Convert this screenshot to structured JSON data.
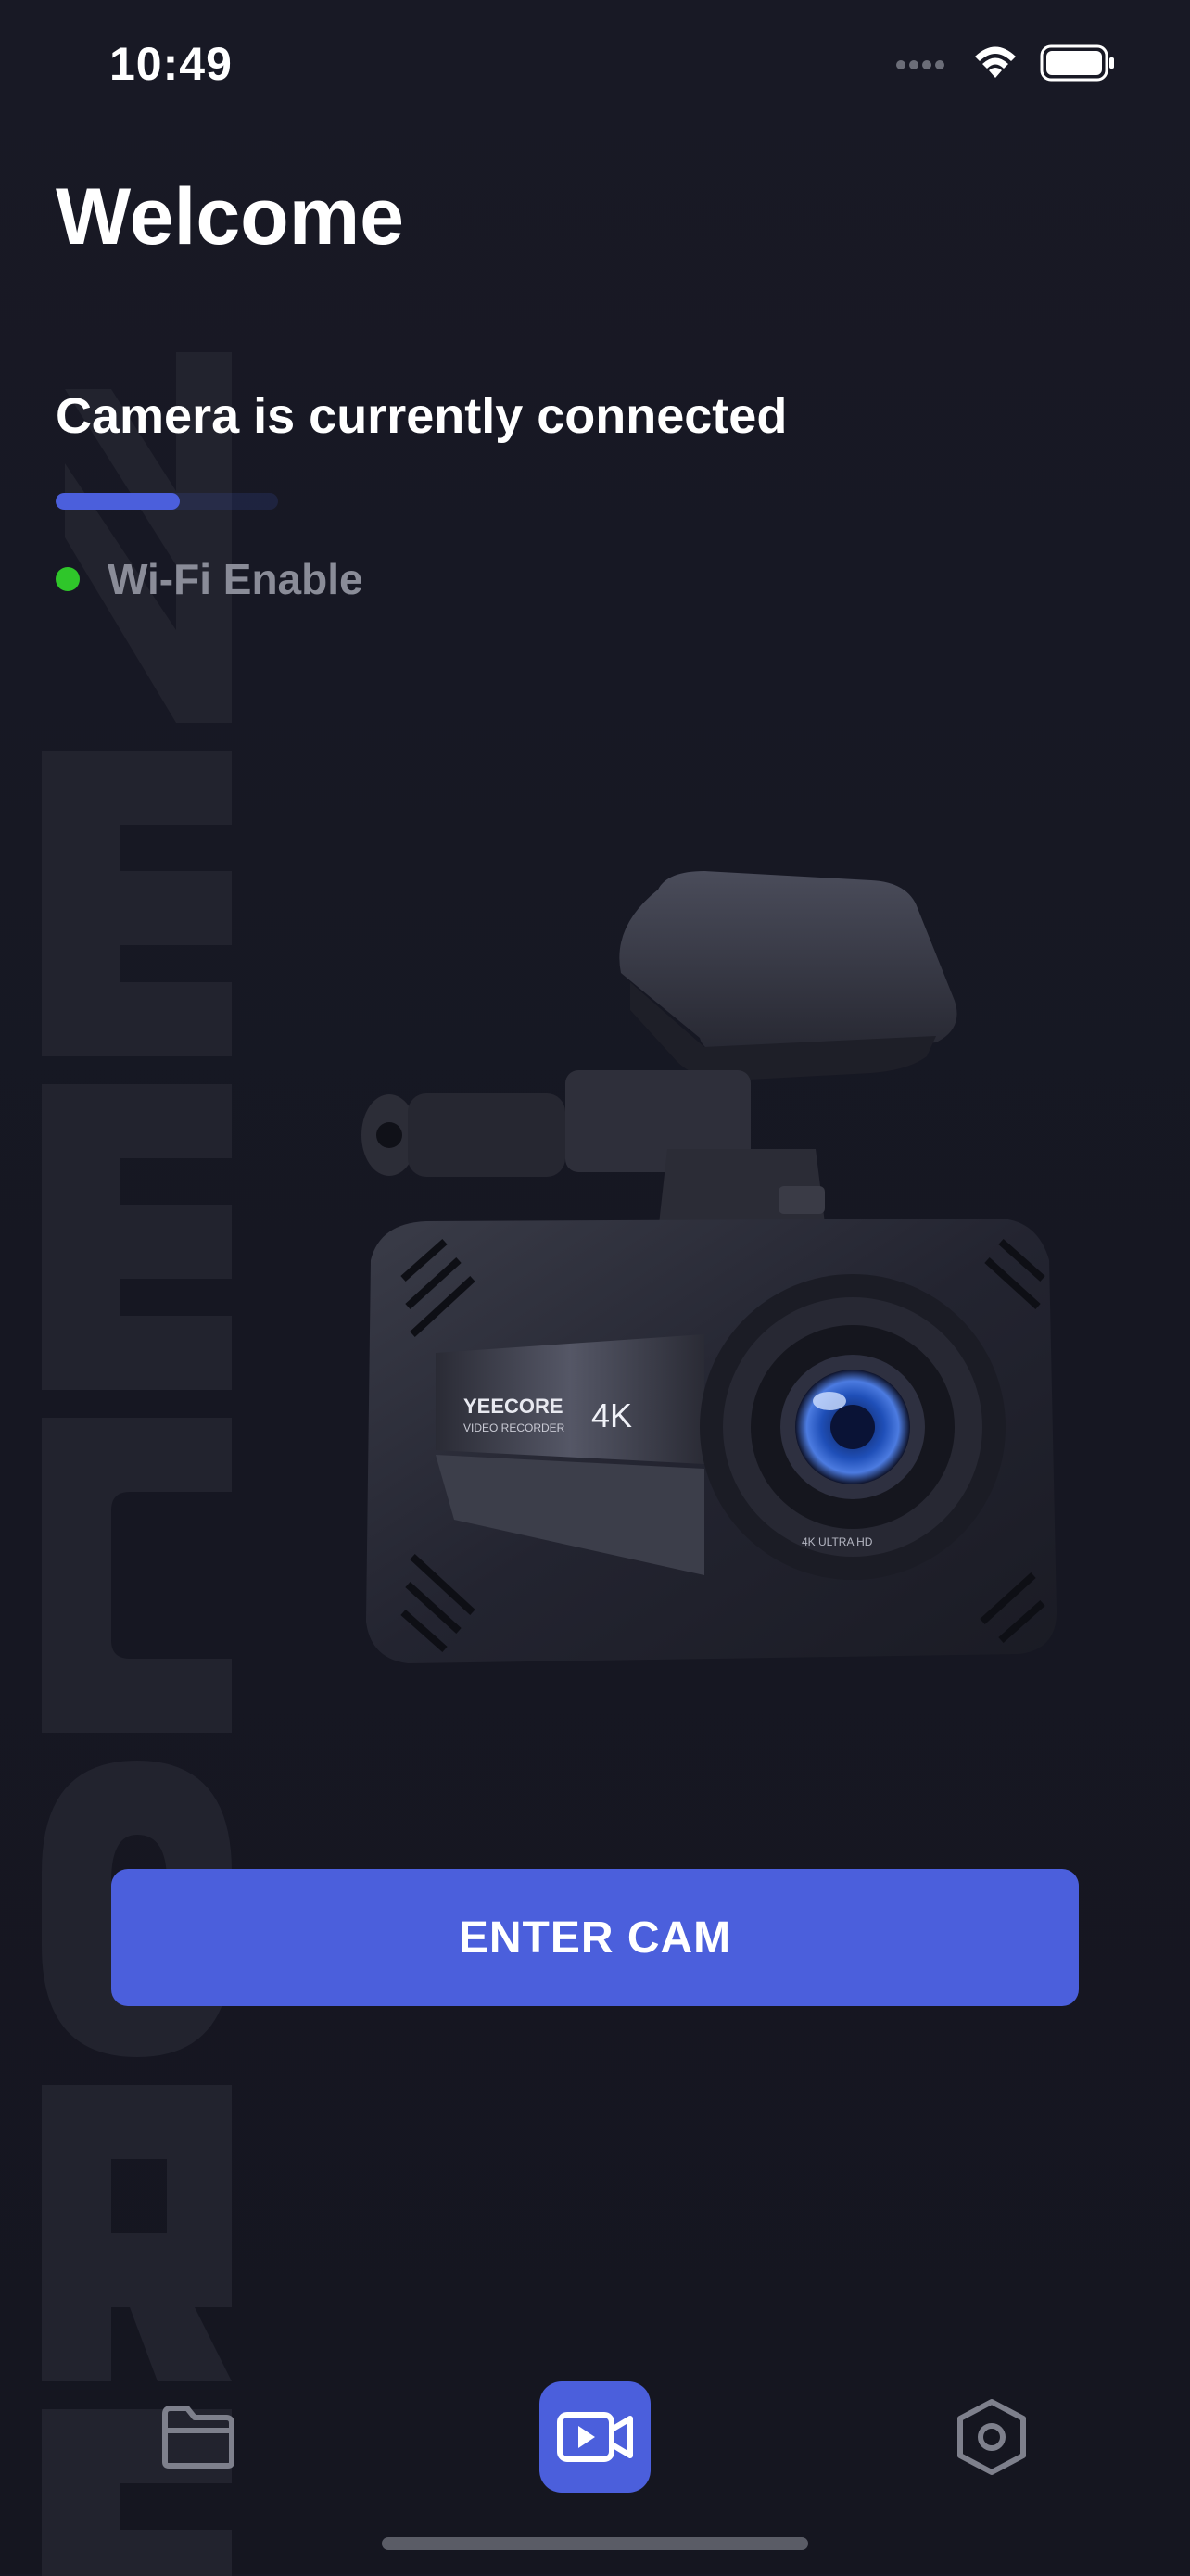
{
  "status_bar": {
    "time": "10:49",
    "icons": [
      "signal-dots-icon",
      "wifi-icon",
      "battery-icon"
    ]
  },
  "header": {
    "title": "Welcome"
  },
  "connection": {
    "status_text": "Camera is currently connected",
    "progress_fraction": 0.56,
    "wifi_label": "Wi-Fi Enable",
    "wifi_status_color": "#2FC62A"
  },
  "camera_image": {
    "logo_text": "YEECORE",
    "model_text": "VIDEO RECORDER",
    "resolution_badge": "4K",
    "lens_ring_text": "4K ULTRA HD"
  },
  "actions": {
    "enter_label": "ENTER CAM"
  },
  "tab_bar": {
    "items": [
      {
        "name": "files",
        "icon": "folder-icon",
        "active": false
      },
      {
        "name": "camera",
        "icon": "video-camera-icon",
        "active": true
      },
      {
        "name": "settings",
        "icon": "hexagon-settings-icon",
        "active": false
      }
    ]
  },
  "colors": {
    "background": "#171824",
    "accent": "#4B5FDC",
    "muted_text": "#8A8C98",
    "status_green": "#2FC62A"
  }
}
